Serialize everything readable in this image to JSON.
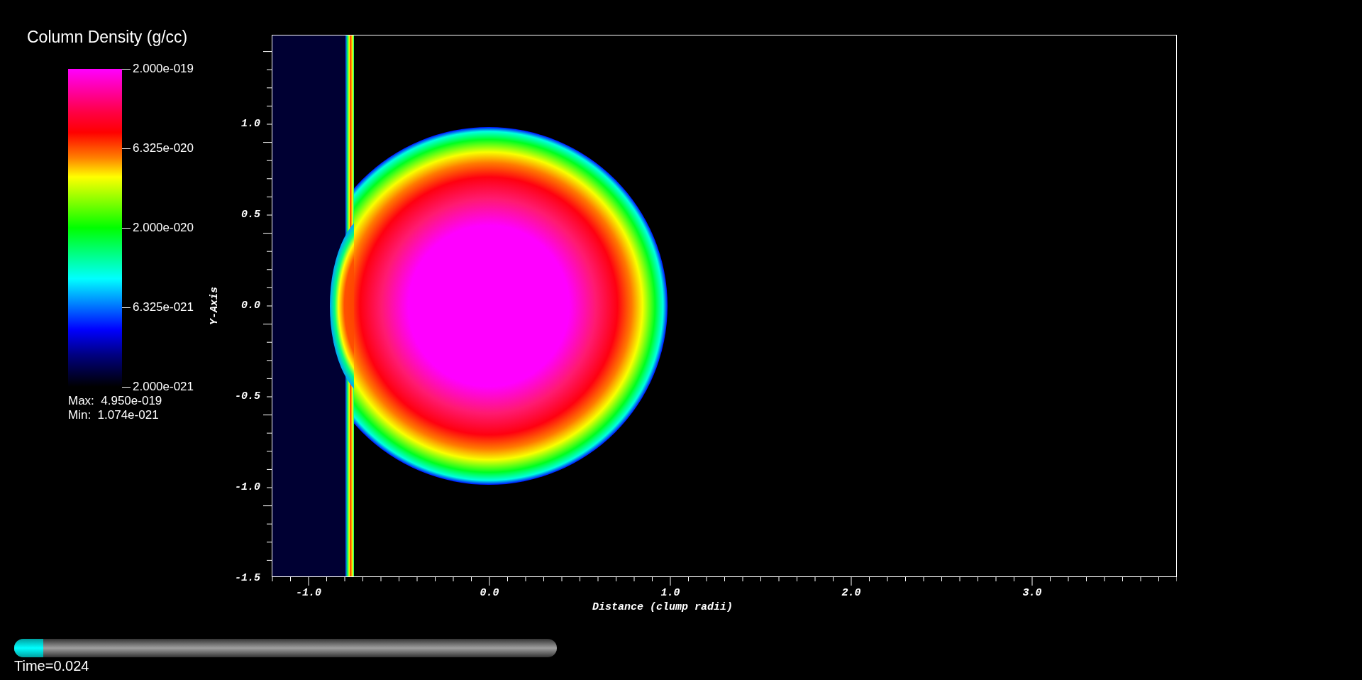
{
  "legend": {
    "title": "Column Density (g/cc)",
    "labels": [
      "2.000e-019",
      "6.325e-020",
      "2.000e-020",
      "6.325e-021",
      "2.000e-021"
    ],
    "max": "Max:  4.950e-019",
    "min": "Min:  1.074e-021"
  },
  "plot": {
    "ylabel": "Y-Axis",
    "yticks": [
      "1.0",
      "0.5",
      "0.0",
      "-0.5",
      "-1.0",
      "-1.5"
    ],
    "xlabel": "Distance (clump radii)",
    "xticks": [
      "-1.0",
      "0.0",
      "1.0",
      "2.0",
      "3.0"
    ]
  },
  "time_slider": {
    "level": 0.054,
    "label": "Time=0.024"
  }
}
